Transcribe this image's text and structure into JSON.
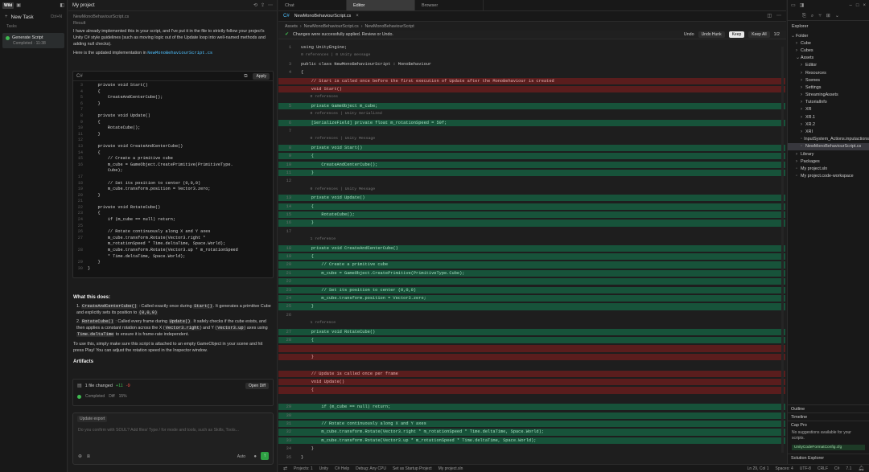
{
  "sidebar": {
    "logo": "Wiki",
    "new_task": "New Task",
    "new_task_shortcut": "Ctrl+N",
    "section": "Tasks",
    "task_title": "Generate Script",
    "task_status": "Completed · 11:38"
  },
  "chat": {
    "project": "My project",
    "filename_hint": "NewMonoBehaviourScript.cs",
    "result_label": "Result",
    "intro": "I have already implemented this in your script, and I've put it in the file to strictly follow your project's Unity C# style guidelines (such as moving logic out of the Update loop into well-named methods and adding null checks).",
    "updated_label": "Here is the updated implementation in",
    "code_lang": "C#",
    "apply": "Apply",
    "code": [
      {
        "n": "3",
        "t": "    private void Start()"
      },
      {
        "n": "4",
        "t": "    {"
      },
      {
        "n": "5",
        "t": "        CreateAndCenterCube();"
      },
      {
        "n": "6",
        "t": "    }"
      },
      {
        "n": "7",
        "t": ""
      },
      {
        "n": "8",
        "t": "    private void Update()"
      },
      {
        "n": "9",
        "t": "    {"
      },
      {
        "n": "10",
        "t": "        RotateCube();"
      },
      {
        "n": "11",
        "t": "    }"
      },
      {
        "n": "12",
        "t": ""
      },
      {
        "n": "13",
        "t": "    private void CreateAndCenterCube()"
      },
      {
        "n": "14",
        "t": "    {"
      },
      {
        "n": "15",
        "t": "        // Create a primitive cube"
      },
      {
        "n": "16",
        "t": "        m_cube = GameObject.CreatePrimitive(PrimitiveType."
      },
      {
        "n": "",
        "t": "        Cube);"
      },
      {
        "n": "17",
        "t": ""
      },
      {
        "n": "18",
        "t": "        // Set its position to center (0,0,0)"
      },
      {
        "n": "19",
        "t": "        m_cube.transform.position = Vector3.zero;"
      },
      {
        "n": "20",
        "t": "    }"
      },
      {
        "n": "21",
        "t": ""
      },
      {
        "n": "22",
        "t": "    private void RotateCube()"
      },
      {
        "n": "23",
        "t": "    {"
      },
      {
        "n": "24",
        "t": "        if (m_cube == null) return;"
      },
      {
        "n": "25",
        "t": ""
      },
      {
        "n": "26",
        "t": "        // Rotate continuously along X and Y axes"
      },
      {
        "n": "27",
        "t": "        m_cube.transform.Rotate(Vector3.right *"
      },
      {
        "n": "",
        "t": "        m_rotationSpeed * Time.deltaTime, Space.World);"
      },
      {
        "n": "28",
        "t": "        m_cube.transform.Rotate(Vector3.up * m_rotationSpeed"
      },
      {
        "n": "",
        "t": "        * Time.deltaTime, Space.World);"
      },
      {
        "n": "29",
        "t": "    }"
      },
      {
        "n": "30",
        "t": "}"
      }
    ],
    "what_title": "What this does:",
    "b1_code": "CreateAndCenterCube()",
    "b1_a": ": Called exactly once during",
    "b1_code2": "Start()",
    "b1_b": ". It generates a primitive Cube and explicitly sets its position to",
    "b1_code3": "(0,0,0)",
    "b2_code": "RotateCube()",
    "b2_a": ": Called every frame during",
    "b2_code2": "Update()",
    "b2_b": ". It safely checks if the cube exists, and then applies a constant rotation across the X (",
    "b2_code3": "Vector3.right",
    "b2_c": ") and Y (",
    "b2_code4": "Vector3.up",
    "b2_d": ") axes using",
    "b2_code5": "Time.deltaTime",
    "b2_e": "to ensure it is frame-rate independent.",
    "outro": "To use this, simply make sure this script is attached to an empty GameObject in your scene and hit press Play! You can adjust the rotation speed in the Inspector window.",
    "artifacts_title": "Artifacts",
    "artifact_file": "1 file changed",
    "artifact_plus": "+11",
    "artifact_minus": "-9",
    "artifact_open": "Open Diff",
    "artifact_status": "Completed",
    "artifact_diff": "Diff",
    "artifact_pct": "15%",
    "composer_chip": "Update export",
    "composer_placeholder": "Do you confirm with SOUL? Add files/ Type / for mode and tools, such as Skills, Tools...",
    "composer_mode": "Auto"
  },
  "editor": {
    "top_tabs": [
      "Chat",
      "Editor",
      "Browser"
    ],
    "active_tab": "Editor",
    "file_tab": "NewMonoBehaviourScript.cs",
    "breadcrumb": [
      "Assets",
      "NewMonoBehaviourScript.cs",
      "NewMonoBehaviourScript"
    ],
    "diff_msg": "Changes were successfully applied. Review or Undo.",
    "diff_undo": "Undo",
    "diff_undo_all": "Undo Hunk",
    "diff_keep": "Keep",
    "diff_keep_all": "Keep All",
    "diff_count": "1/2",
    "lines": [
      {
        "n": "1",
        "t": "using UnityEngine;",
        "k": ""
      },
      {
        "n": "",
        "t": "0 references | 0 Unity message",
        "k": "lens"
      },
      {
        "n": "3",
        "t": "public class NewMonoBehaviourScript : MonoBehaviour",
        "k": ""
      },
      {
        "n": "4",
        "t": "{",
        "k": ""
      },
      {
        "n": "",
        "t": "    // Start is called once before the first execution of Update after the MonoBehaviour is created",
        "k": "del"
      },
      {
        "n": "",
        "t": "    void Start()",
        "k": "del"
      },
      {
        "n": "",
        "t": "    0 references",
        "k": "lens"
      },
      {
        "n": "5",
        "t": "    private GameObject m_cube;",
        "k": "add"
      },
      {
        "n": "",
        "t": "    0 references | Unity Serialized",
        "k": "lens"
      },
      {
        "n": "6",
        "t": "    [SerializeField] private float m_rotationSpeed = 50f;",
        "k": "add"
      },
      {
        "n": "7",
        "t": "",
        "k": ""
      },
      {
        "n": "",
        "t": "    0 references | Unity Message",
        "k": "lens"
      },
      {
        "n": "8",
        "t": "    private void Start()",
        "k": "add"
      },
      {
        "n": "9",
        "t": "    {",
        "k": "add"
      },
      {
        "n": "10",
        "t": "        CreateAndCenterCube();",
        "k": "add"
      },
      {
        "n": "11",
        "t": "    }",
        "k": "add"
      },
      {
        "n": "12",
        "t": "",
        "k": ""
      },
      {
        "n": "",
        "t": "    0 references | Unity Message",
        "k": "lens"
      },
      {
        "n": "13",
        "t": "    private void Update()",
        "k": "add"
      },
      {
        "n": "14",
        "t": "    {",
        "k": "add"
      },
      {
        "n": "15",
        "t": "        RotateCube();",
        "k": "add"
      },
      {
        "n": "16",
        "t": "    }",
        "k": "add"
      },
      {
        "n": "17",
        "t": "",
        "k": ""
      },
      {
        "n": "",
        "t": "    1 reference",
        "k": "lens"
      },
      {
        "n": "18",
        "t": "    private void CreateAndCenterCube()",
        "k": "add"
      },
      {
        "n": "19",
        "t": "    {",
        "k": "add"
      },
      {
        "n": "20",
        "t": "        // Create a primitive cube",
        "k": "add"
      },
      {
        "n": "21",
        "t": "        m_cube = GameObject.CreatePrimitive(PrimitiveType.Cube);",
        "k": "add"
      },
      {
        "n": "22",
        "t": "",
        "k": "add"
      },
      {
        "n": "23",
        "t": "        // Set its position to center (0,0,0)",
        "k": "add"
      },
      {
        "n": "24",
        "t": "        m_cube.transform.position = Vector3.zero;",
        "k": "add"
      },
      {
        "n": "25",
        "t": "    }",
        "k": "add"
      },
      {
        "n": "26",
        "t": "",
        "k": ""
      },
      {
        "n": "",
        "t": "    1 reference",
        "k": "lens"
      },
      {
        "n": "27",
        "t": "    private void RotateCube()",
        "k": "add"
      },
      {
        "n": "28",
        "t": "    {",
        "k": "add"
      },
      {
        "n": "",
        "t": "",
        "k": "del"
      },
      {
        "n": "",
        "t": "    }",
        "k": "del"
      },
      {
        "n": "",
        "t": "",
        "k": ""
      },
      {
        "n": "",
        "t": "    // Update is called once per frame",
        "k": "del"
      },
      {
        "n": "",
        "t": "    void Update()",
        "k": "del"
      },
      {
        "n": "",
        "t": "    {",
        "k": "del"
      },
      {
        "n": "",
        "t": "",
        "k": ""
      },
      {
        "n": "29",
        "t": "        if (m_cube == null) return;",
        "k": "add"
      },
      {
        "n": "30",
        "t": "",
        "k": "add"
      },
      {
        "n": "31",
        "t": "        // Rotate continuously along X and Y axes",
        "k": "add"
      },
      {
        "n": "32",
        "t": "        m_cube.transform.Rotate(Vector3.right * m_rotationSpeed * Time.deltaTime, Space.World);",
        "k": "add"
      },
      {
        "n": "33",
        "t": "        m_cube.transform.Rotate(Vector3.up * m_rotationSpeed * Time.deltaTime, Space.World);",
        "k": "add"
      },
      {
        "n": "34",
        "t": "    }",
        "k": ""
      },
      {
        "n": "35",
        "t": "}",
        "k": ""
      }
    ]
  },
  "explorer": {
    "title": "Explorer",
    "items": [
      {
        "label": "Folder",
        "depth": 0,
        "kind": "folder",
        "open": true
      },
      {
        "label": "Cube",
        "depth": 1,
        "kind": "folder"
      },
      {
        "label": "Cubes",
        "depth": 1,
        "kind": "folder"
      },
      {
        "label": "Assets",
        "depth": 1,
        "kind": "folder",
        "open": true
      },
      {
        "label": "Editor",
        "depth": 2,
        "kind": "folder"
      },
      {
        "label": "Resources",
        "depth": 2,
        "kind": "folder"
      },
      {
        "label": "Scenes",
        "depth": 2,
        "kind": "folder"
      },
      {
        "label": "Settings",
        "depth": 2,
        "kind": "folder"
      },
      {
        "label": "StreamingAssets",
        "depth": 2,
        "kind": "folder"
      },
      {
        "label": "TutorialInfo",
        "depth": 2,
        "kind": "folder"
      },
      {
        "label": "XR",
        "depth": 2,
        "kind": "folder"
      },
      {
        "label": "XR.1",
        "depth": 2,
        "kind": "folder"
      },
      {
        "label": "XR.2",
        "depth": 2,
        "kind": "folder"
      },
      {
        "label": "XRI",
        "depth": 2,
        "kind": "folder"
      },
      {
        "label": "InputSystem_Actions.inputactions",
        "depth": 2,
        "kind": "file"
      },
      {
        "label": "NewMonoBehaviourScript.cs",
        "depth": 2,
        "kind": "file",
        "selected": true
      },
      {
        "label": "Library",
        "depth": 1,
        "kind": "folder"
      },
      {
        "label": "Packages",
        "depth": 1,
        "kind": "folder"
      },
      {
        "label": "My project.sln",
        "depth": 1,
        "kind": "file"
      },
      {
        "label": "My project.code-workspace",
        "depth": 1,
        "kind": "file"
      }
    ],
    "outline": "Outline",
    "timeline": "Timeline",
    "copilot_title": "Cap Pro",
    "copilot_text": "No suggestions available for your scripts.",
    "copilot_item": "UnityCodeFormatConfig.cfg",
    "solution": "Solution Explorer"
  },
  "status": {
    "left": "Projects: 1",
    "branch": "Unity",
    "items": [
      "C# Help",
      "Debug: Any CPU",
      "Set as Startup Project",
      "My project.sln"
    ],
    "right": [
      "Ln 29, Col 1",
      "Spaces: 4",
      "UTF-8",
      "CRLF",
      "C#",
      "7.1"
    ]
  },
  "colors": {
    "del_bg": "#5a1d1d",
    "add_bg": "#17533a",
    "accent": "#2ea043",
    "link": "#4fc1ff"
  }
}
